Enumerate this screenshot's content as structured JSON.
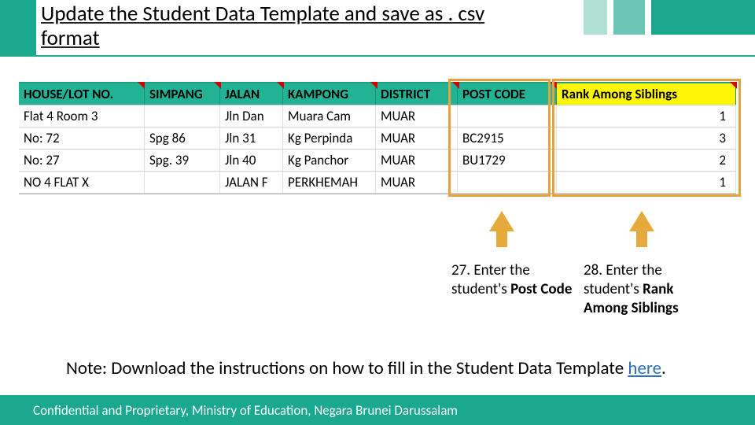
{
  "colors": {
    "accent": "#1aa88f",
    "highlight": "#e8a23a",
    "yellow": "#fff606",
    "link": "#2a6fc2"
  },
  "title": "Update the Student Data Template and save as . csv format",
  "table": {
    "headers": [
      "HOUSE/LOT NO.",
      "SIMPANG",
      "JALAN",
      "KAMPONG",
      "DISTRICT",
      "POST CODE",
      "Rank Among Siblings"
    ],
    "rows": [
      {
        "house": "Flat 4 Room 3",
        "simpang": "",
        "jalan": "Jln Dan",
        "kampong": "Muara Cam",
        "district": "MUAR",
        "postcode": "",
        "rank": "1"
      },
      {
        "house": "No: 72",
        "simpang": "Spg 86",
        "jalan": "Jln 31",
        "kampong": "Kg Perpinda",
        "district": "MUAR",
        "postcode": "BC2915",
        "rank": "3"
      },
      {
        "house": "No: 27",
        "simpang": "Spg. 39",
        "jalan": "Jln 40",
        "kampong": "Kg Panchor",
        "district": "MUAR",
        "postcode": "BU1729",
        "rank": "2"
      },
      {
        "house": "NO 4 FLAT X",
        "simpang": "",
        "jalan": "JALAN F",
        "kampong": "PERKHEMAH",
        "district": "MUAR",
        "postcode": "",
        "rank": "1"
      }
    ]
  },
  "callouts": {
    "c27": {
      "lead": "27. Enter the student's ",
      "bold": "Post Code"
    },
    "c28": {
      "lead": "28. Enter the student's ",
      "bold": "Rank Among Siblings"
    }
  },
  "note": {
    "text": "Note: Download the instructions on how to fill in the Student Data Template ",
    "link_text": "here",
    "tail": "."
  },
  "footer": "Confidential and Proprietary, Ministry of Education, Negara Brunei Darussalam"
}
